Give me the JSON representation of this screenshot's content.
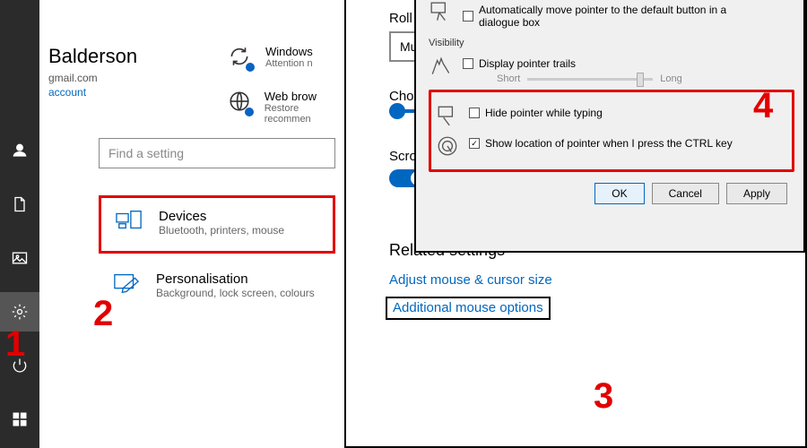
{
  "taskbar": {
    "icons": [
      "user",
      "document",
      "picture",
      "settings",
      "power",
      "start"
    ]
  },
  "account": {
    "name_fragment": "Balderson",
    "email_fragment": "gmail.com",
    "link_fragment": "account"
  },
  "recommendations": [
    {
      "title": "Windows",
      "sub": "Attention n"
    },
    {
      "title": "Web brow",
      "sub": "Restore\nrecommen"
    }
  ],
  "search": {
    "placeholder": "Find a setting"
  },
  "tiles": {
    "devices": {
      "title": "Devices",
      "sub": "Bluetooth, printers, mouse"
    },
    "personalisation": {
      "title": "Personalisation",
      "sub": "Background, lock screen, colours"
    }
  },
  "mouse_page": {
    "roll_label": "Roll the",
    "roll_value": "Multi",
    "choose_label": "Choose",
    "scroll_label": "Scroll i",
    "related_heading": "Related settings",
    "link_adjust": "Adjust mouse & cursor size",
    "link_additional": "Additional mouse options"
  },
  "dialog": {
    "snapto_label": "Automatically move pointer to the default button in a dialogue box",
    "visibility_label": "Visibility",
    "trails_label": "Display pointer trails",
    "trails_short": "Short",
    "trails_long": "Long",
    "hide_label": "Hide pointer while typing",
    "ctrl_label": "Show location of pointer when I press the CTRL key",
    "btn_ok": "OK",
    "btn_cancel": "Cancel",
    "btn_apply": "Apply"
  },
  "annotations": {
    "n1": "1",
    "n2": "2",
    "n3": "3",
    "n4": "4"
  }
}
